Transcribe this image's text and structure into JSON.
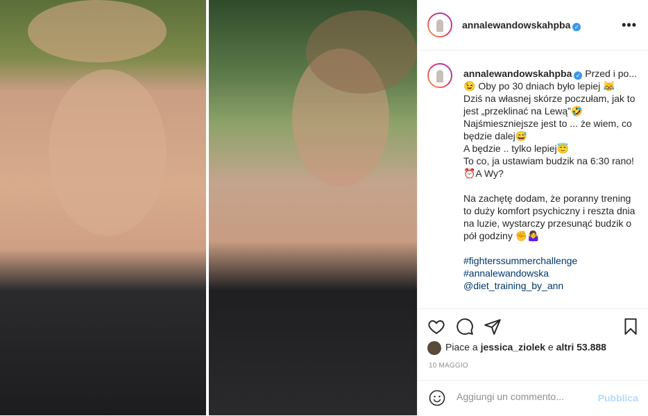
{
  "post": {
    "username": "annalewandowskahpba",
    "verified_glyph": "✓",
    "more_label": "•••",
    "caption": {
      "lines": [
        "Przed i po...😉 Oby po 30 dniach było lepiej 😹",
        "Dziś na własnej skórze poczułam, jak to jest „przeklinać na Lewą”🤣",
        "Najśmieszniejsze jest to ... że wiem, co będzie dalej😅",
        "A będzie .. tylko lepiej😇",
        "To co, ja ustawiam budzik na 6:30 rano!⏰A Wy?"
      ],
      "paragraph2": "Na zachętę dodam, że poranny trening to duży komfort psychiczny i reszta dnia na luzie, wystarczy przesunąć budzik o pół godziny ✊🤷‍♀️",
      "hashtags": [
        "#fighterssummerchallenge",
        "#annalewandowska",
        "@diet_training_by_ann"
      ]
    },
    "likes": {
      "prefix": "Piace a",
      "user": "jessica_ziolek",
      "middle": "e",
      "others": "altri 53.888"
    },
    "date": "10 MAGGIO",
    "comment_placeholder": "Aggiungi un commento...",
    "publish_label": "Pubblica"
  },
  "icons": {
    "like": "heart-icon",
    "comment": "comment-icon",
    "share": "share-icon",
    "save": "bookmark-icon",
    "emoji": "emoji-icon",
    "more": "more-icon"
  },
  "colors": {
    "text": "#262626",
    "muted": "#8e8e8e",
    "link": "#00376b",
    "verified": "#3897f0",
    "publish_disabled": "#b3dbff"
  }
}
